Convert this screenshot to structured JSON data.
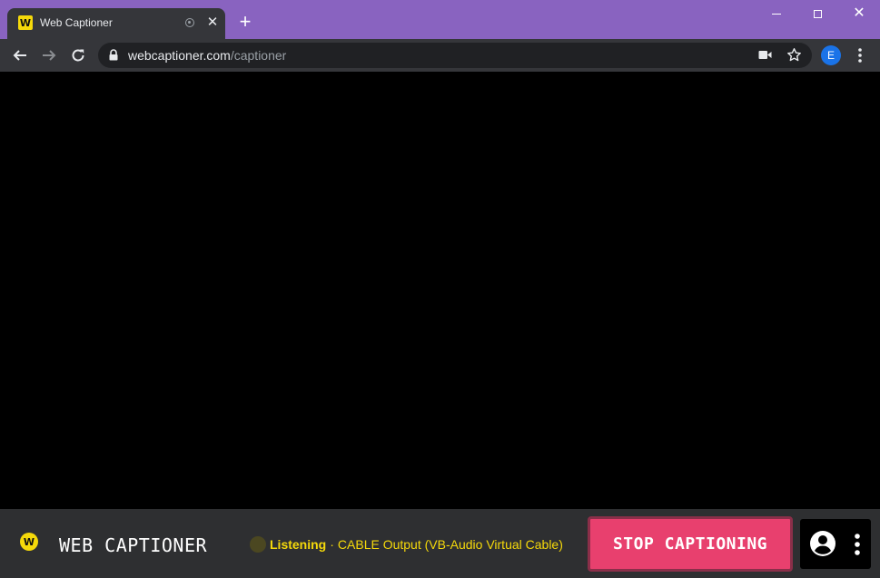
{
  "browser": {
    "tab": {
      "title": "Web Captioner",
      "favicon_letter": "W",
      "favicon_icon": "web-captioner-logo-icon",
      "audio_indicator_icon": "recording-indicator-icon",
      "close_label": "✕"
    },
    "new_tab_label": "+",
    "window_controls": {
      "minimize_icon": "minimize-icon",
      "maximize_icon": "maximize-icon",
      "close_label": "✕"
    },
    "address_bar": {
      "host": "webcaptioner.com",
      "path": "/captioner",
      "lock_icon": "lock-icon",
      "camera_icon": "camera-icon",
      "bookmark_icon": "star-icon"
    },
    "profile_initial": "E",
    "menu_icon": "kebab-menu-icon",
    "accent_color": "#8963c0"
  },
  "app": {
    "logo_letter": "W",
    "brand_name": "WEB CAPTIONER",
    "status": {
      "state": "Listening",
      "separator": "·",
      "device": "CABLE Output (VB-Audio Virtual Cable)"
    },
    "stop_button_label": "STOP CAPTIONING",
    "user_icon": "account-circle-icon",
    "more_icon": "more-vertical-icon",
    "colors": {
      "brand_yellow": "#f5d90a",
      "stop_button": "#e8406e",
      "stage_background": "#000000",
      "bar_background": "#2e2f31"
    }
  }
}
